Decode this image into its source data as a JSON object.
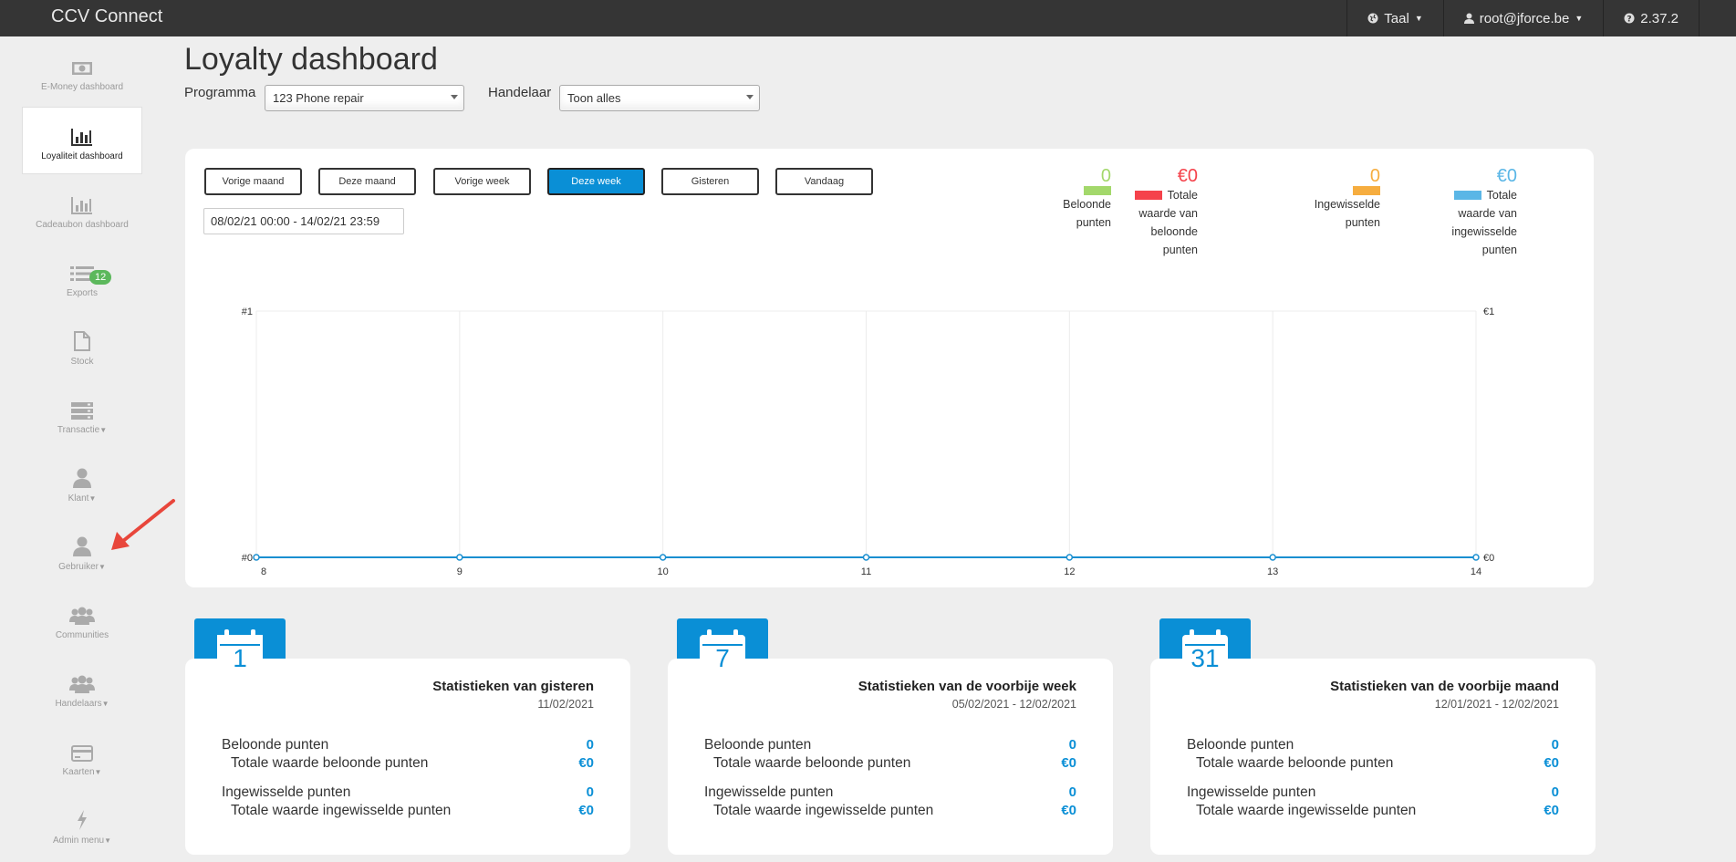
{
  "navbar": {
    "brand": "CCV Connect",
    "language_label": "Taal",
    "user_label": "root@jforce.be",
    "version_label": "2.37.2"
  },
  "sidebar": {
    "items": [
      {
        "label": "E-Money dashboard",
        "icon": "money-icon"
      },
      {
        "label": "Loyaliteit dashboard",
        "icon": "bar-chart-icon",
        "active": true
      },
      {
        "label": "Cadeaubon dashboard",
        "icon": "bar-chart-icon"
      },
      {
        "label": "Exports",
        "icon": "list-icon",
        "badge": "12"
      },
      {
        "label": "Stock",
        "icon": "file-icon"
      },
      {
        "label": "Transactie",
        "icon": "server-icon",
        "caret": true
      },
      {
        "label": "Klant",
        "icon": "user-icon",
        "caret": true
      },
      {
        "label": "Gebruiker",
        "icon": "user-icon",
        "caret": true
      },
      {
        "label": "Communities",
        "icon": "users-icon"
      },
      {
        "label": "Handelaars",
        "icon": "users-icon",
        "caret": true
      },
      {
        "label": "Kaarten",
        "icon": "credit-card-icon",
        "caret": true
      },
      {
        "label": "Admin menu",
        "icon": "bolt-icon",
        "caret": true
      }
    ]
  },
  "header": {
    "title": "Loyalty dashboard",
    "program_label": "Programma",
    "program_value": "123 Phone repair",
    "merchant_label": "Handelaar",
    "merchant_value": "Toon alles"
  },
  "range_buttons": [
    "Vorige maand",
    "Deze maand",
    "Vorige week",
    "Deze week",
    "Gisteren",
    "Vandaag"
  ],
  "active_range": "Deze week",
  "date_range": "08/02/21 00:00 - 14/02/21 23:59",
  "legend": [
    {
      "value": "0",
      "lines": [
        "Beloonde",
        "punten"
      ],
      "color": "#a3d86b"
    },
    {
      "value": "€0",
      "lines": [
        "Totale",
        "waarde van",
        "beloonde",
        "punten"
      ],
      "color": "#f5424b"
    },
    {
      "value": "0",
      "lines": [
        "Ingewisselde",
        "punten"
      ],
      "color": "#f6ad3f"
    },
    {
      "value": "€0",
      "lines": [
        "Totale",
        "waarde van",
        "ingewisselde",
        "punten"
      ],
      "color": "#5ab6e6"
    }
  ],
  "chart_data": {
    "type": "line",
    "x": [
      "8",
      "9",
      "10",
      "11",
      "12",
      "13",
      "14"
    ],
    "y_left_ticks": [
      "#0",
      "#1"
    ],
    "y_right_ticks": [
      "€0",
      "€1"
    ],
    "series": [
      {
        "values": [
          0,
          0,
          0,
          0,
          0,
          0,
          0
        ],
        "color": "#1a8fd0"
      }
    ],
    "ylim": [
      0,
      1
    ],
    "grid": true
  },
  "cards": [
    {
      "calendar_number": "1",
      "title": "Statistieken van gisteren",
      "subtitle": "11/02/2021",
      "rows": [
        {
          "label": "Beloonde punten",
          "value": "0"
        },
        {
          "label": "Totale waarde beloonde punten",
          "value": "€0"
        },
        {
          "label": "Ingewisselde punten",
          "value": "0"
        },
        {
          "label": "Totale waarde ingewisselde punten",
          "value": "€0"
        }
      ]
    },
    {
      "calendar_number": "7",
      "title": "Statistieken van de voorbije week",
      "subtitle": "05/02/2021 - 12/02/2021",
      "rows": [
        {
          "label": "Beloonde punten",
          "value": "0"
        },
        {
          "label": "Totale waarde beloonde punten",
          "value": "€0"
        },
        {
          "label": "Ingewisselde punten",
          "value": "0"
        },
        {
          "label": "Totale waarde ingewisselde punten",
          "value": "€0"
        }
      ]
    },
    {
      "calendar_number": "31",
      "title": "Statistieken van de voorbije maand",
      "subtitle": "12/01/2021 - 12/02/2021",
      "rows": [
        {
          "label": "Beloonde punten",
          "value": "0"
        },
        {
          "label": "Totale waarde beloonde punten",
          "value": "€0"
        },
        {
          "label": "Ingewisselde punten",
          "value": "0"
        },
        {
          "label": "Totale waarde ingewisselde punten",
          "value": "€0"
        }
      ]
    }
  ],
  "colors": {
    "accent": "#0a8fd6",
    "navbar": "#353535",
    "badge": "#5cb85c",
    "annotation_arrow": "#e8463b"
  }
}
